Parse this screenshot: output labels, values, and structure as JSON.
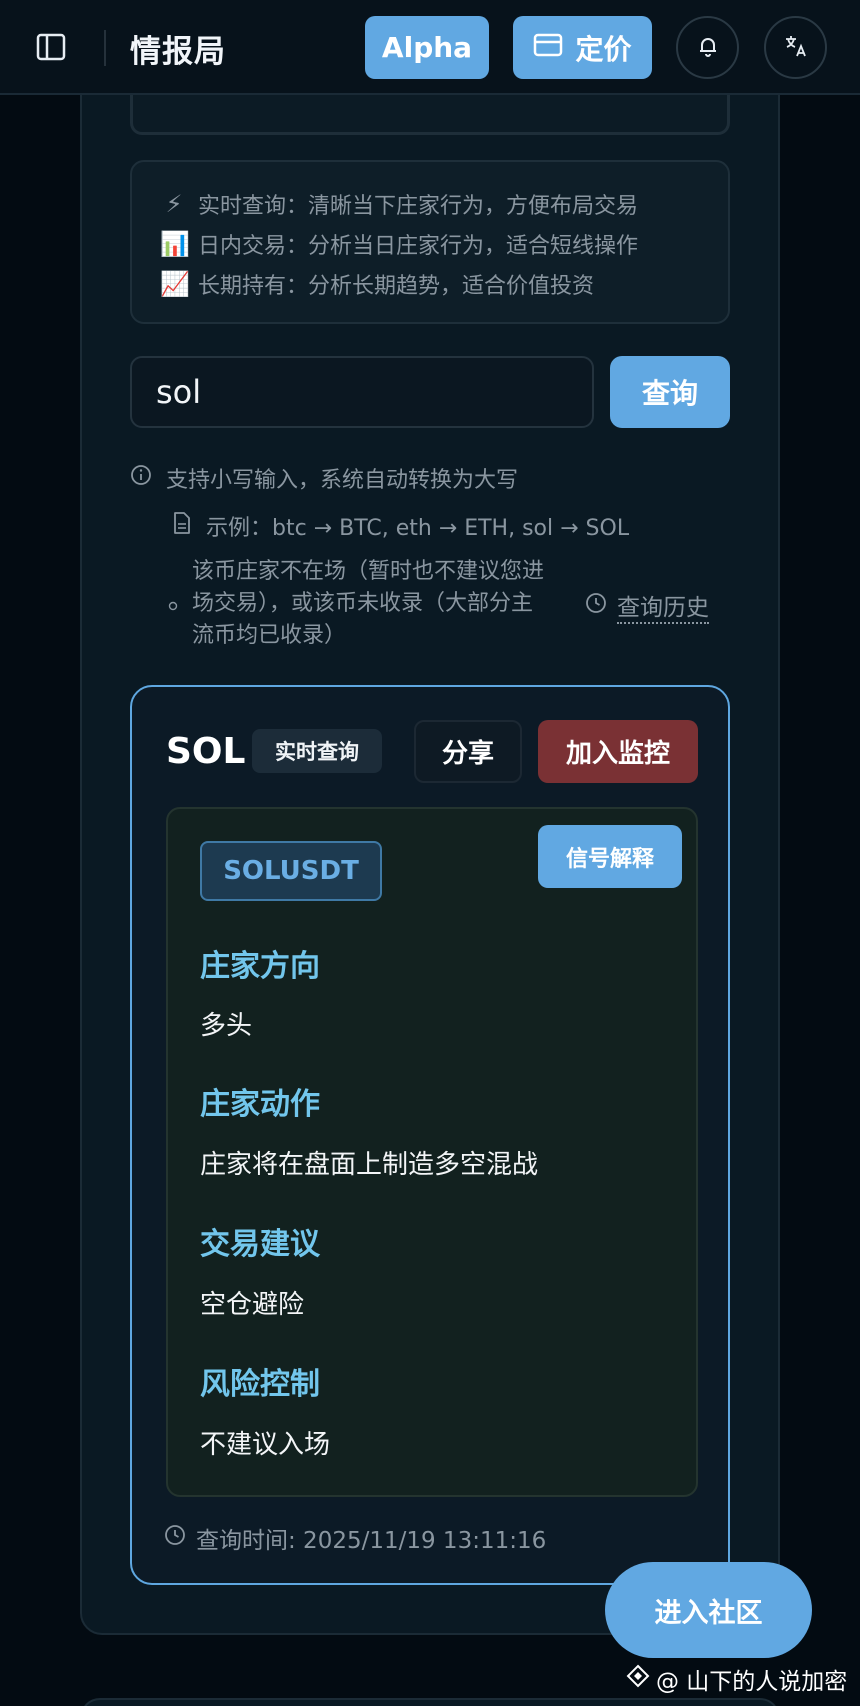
{
  "header": {
    "title": "情报局",
    "alpha_label": "Alpha",
    "pricing_label": "定价"
  },
  "info": {
    "lines": [
      {
        "emoji": "⚡",
        "text": "实时查询：清晰当下庄家行为，方便布局交易"
      },
      {
        "emoji": "📊",
        "text": "日内交易：分析当日庄家行为，适合短线操作"
      },
      {
        "emoji": "📈",
        "text": "长期持有：分析长期趋势，适合价值投资"
      }
    ]
  },
  "search": {
    "value": "sol",
    "button_label": "查询"
  },
  "hints": {
    "lowercase": "支持小写输入，系统自动转换为大写",
    "example": "示例：btc → BTC, eth → ETH, sol → SOL",
    "not_listed": "该币庄家不在场（暂时也不建议您进场交易），或该币未收录（大部分主流币均已收录）",
    "history_label": "查询历史"
  },
  "result": {
    "symbol": "SOL",
    "mode": "实时查询",
    "share_label": "分享",
    "monitor_label": "加入监控",
    "pair": "SOLUSDT",
    "explain_label": "信号解释",
    "sections": [
      {
        "title": "庄家方向",
        "value": "多头"
      },
      {
        "title": "庄家动作",
        "value": "庄家将在盘面上制造多空混战"
      },
      {
        "title": "交易建议",
        "value": "空仓避险"
      },
      {
        "title": "风险控制",
        "value": "不建议入场"
      }
    ],
    "query_time": "查询时间: 2025/11/19 13:11:16"
  },
  "community_label": "进入社区",
  "watermark": "@ 山下的人说加密",
  "colors": {
    "accent": "#61a8e2",
    "danger": "#7a3134",
    "section_title": "#72c6ec"
  }
}
